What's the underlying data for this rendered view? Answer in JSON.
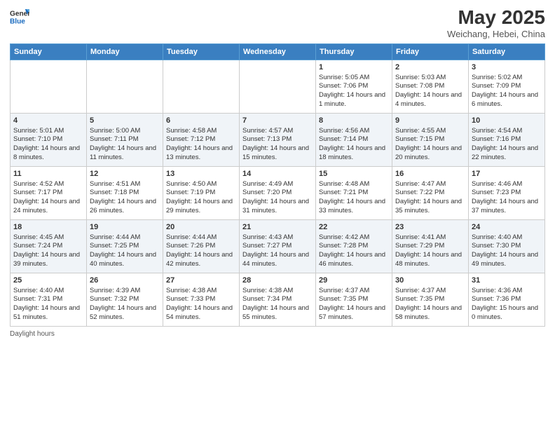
{
  "logo": {
    "line1": "General",
    "line2": "Blue"
  },
  "title": "May 2025",
  "location": "Weichang, Hebei, China",
  "days_of_week": [
    "Sunday",
    "Monday",
    "Tuesday",
    "Wednesday",
    "Thursday",
    "Friday",
    "Saturday"
  ],
  "footer_label": "Daylight hours",
  "weeks": [
    [
      {
        "day": "",
        "content": ""
      },
      {
        "day": "",
        "content": ""
      },
      {
        "day": "",
        "content": ""
      },
      {
        "day": "",
        "content": ""
      },
      {
        "day": "1",
        "content": "Sunrise: 5:05 AM\nSunset: 7:06 PM\nDaylight: 14 hours and 1 minute."
      },
      {
        "day": "2",
        "content": "Sunrise: 5:03 AM\nSunset: 7:08 PM\nDaylight: 14 hours and 4 minutes."
      },
      {
        "day": "3",
        "content": "Sunrise: 5:02 AM\nSunset: 7:09 PM\nDaylight: 14 hours and 6 minutes."
      }
    ],
    [
      {
        "day": "4",
        "content": "Sunrise: 5:01 AM\nSunset: 7:10 PM\nDaylight: 14 hours and 8 minutes."
      },
      {
        "day": "5",
        "content": "Sunrise: 5:00 AM\nSunset: 7:11 PM\nDaylight: 14 hours and 11 minutes."
      },
      {
        "day": "6",
        "content": "Sunrise: 4:58 AM\nSunset: 7:12 PM\nDaylight: 14 hours and 13 minutes."
      },
      {
        "day": "7",
        "content": "Sunrise: 4:57 AM\nSunset: 7:13 PM\nDaylight: 14 hours and 15 minutes."
      },
      {
        "day": "8",
        "content": "Sunrise: 4:56 AM\nSunset: 7:14 PM\nDaylight: 14 hours and 18 minutes."
      },
      {
        "day": "9",
        "content": "Sunrise: 4:55 AM\nSunset: 7:15 PM\nDaylight: 14 hours and 20 minutes."
      },
      {
        "day": "10",
        "content": "Sunrise: 4:54 AM\nSunset: 7:16 PM\nDaylight: 14 hours and 22 minutes."
      }
    ],
    [
      {
        "day": "11",
        "content": "Sunrise: 4:52 AM\nSunset: 7:17 PM\nDaylight: 14 hours and 24 minutes."
      },
      {
        "day": "12",
        "content": "Sunrise: 4:51 AM\nSunset: 7:18 PM\nDaylight: 14 hours and 26 minutes."
      },
      {
        "day": "13",
        "content": "Sunrise: 4:50 AM\nSunset: 7:19 PM\nDaylight: 14 hours and 29 minutes."
      },
      {
        "day": "14",
        "content": "Sunrise: 4:49 AM\nSunset: 7:20 PM\nDaylight: 14 hours and 31 minutes."
      },
      {
        "day": "15",
        "content": "Sunrise: 4:48 AM\nSunset: 7:21 PM\nDaylight: 14 hours and 33 minutes."
      },
      {
        "day": "16",
        "content": "Sunrise: 4:47 AM\nSunset: 7:22 PM\nDaylight: 14 hours and 35 minutes."
      },
      {
        "day": "17",
        "content": "Sunrise: 4:46 AM\nSunset: 7:23 PM\nDaylight: 14 hours and 37 minutes."
      }
    ],
    [
      {
        "day": "18",
        "content": "Sunrise: 4:45 AM\nSunset: 7:24 PM\nDaylight: 14 hours and 39 minutes."
      },
      {
        "day": "19",
        "content": "Sunrise: 4:44 AM\nSunset: 7:25 PM\nDaylight: 14 hours and 40 minutes."
      },
      {
        "day": "20",
        "content": "Sunrise: 4:44 AM\nSunset: 7:26 PM\nDaylight: 14 hours and 42 minutes."
      },
      {
        "day": "21",
        "content": "Sunrise: 4:43 AM\nSunset: 7:27 PM\nDaylight: 14 hours and 44 minutes."
      },
      {
        "day": "22",
        "content": "Sunrise: 4:42 AM\nSunset: 7:28 PM\nDaylight: 14 hours and 46 minutes."
      },
      {
        "day": "23",
        "content": "Sunrise: 4:41 AM\nSunset: 7:29 PM\nDaylight: 14 hours and 48 minutes."
      },
      {
        "day": "24",
        "content": "Sunrise: 4:40 AM\nSunset: 7:30 PM\nDaylight: 14 hours and 49 minutes."
      }
    ],
    [
      {
        "day": "25",
        "content": "Sunrise: 4:40 AM\nSunset: 7:31 PM\nDaylight: 14 hours and 51 minutes."
      },
      {
        "day": "26",
        "content": "Sunrise: 4:39 AM\nSunset: 7:32 PM\nDaylight: 14 hours and 52 minutes."
      },
      {
        "day": "27",
        "content": "Sunrise: 4:38 AM\nSunset: 7:33 PM\nDaylight: 14 hours and 54 minutes."
      },
      {
        "day": "28",
        "content": "Sunrise: 4:38 AM\nSunset: 7:34 PM\nDaylight: 14 hours and 55 minutes."
      },
      {
        "day": "29",
        "content": "Sunrise: 4:37 AM\nSunset: 7:35 PM\nDaylight: 14 hours and 57 minutes."
      },
      {
        "day": "30",
        "content": "Sunrise: 4:37 AM\nSunset: 7:35 PM\nDaylight: 14 hours and 58 minutes."
      },
      {
        "day": "31",
        "content": "Sunrise: 4:36 AM\nSunset: 7:36 PM\nDaylight: 15 hours and 0 minutes."
      }
    ]
  ]
}
